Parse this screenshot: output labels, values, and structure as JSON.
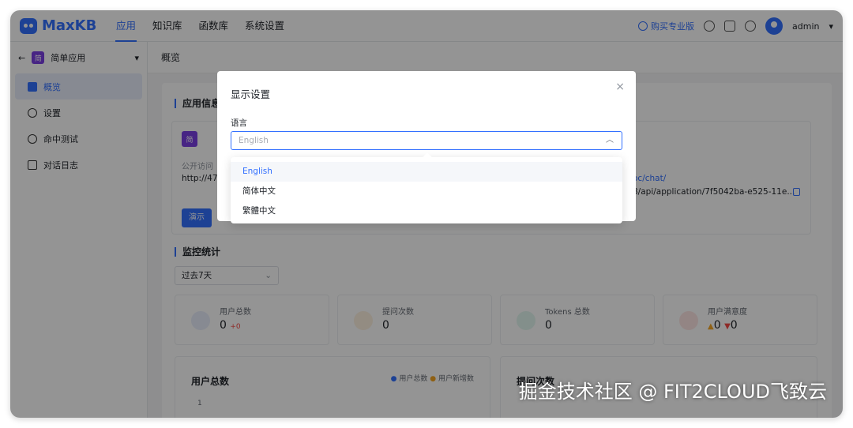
{
  "app": {
    "name": "MaxKB"
  },
  "nav": {
    "items": [
      "应用",
      "知识库",
      "函数库",
      "系统设置"
    ]
  },
  "topright": {
    "buy": "购买专业版",
    "user": "admin"
  },
  "sidebar": {
    "app_name": "简单应用",
    "app_badge": "简",
    "items": [
      {
        "label": "概览",
        "icon": "grid-icon"
      },
      {
        "label": "设置",
        "icon": "gear-icon"
      },
      {
        "label": "命中测试",
        "icon": "target-icon"
      },
      {
        "label": "对话日志",
        "icon": "log-icon"
      }
    ]
  },
  "page": {
    "title": "概览"
  },
  "app_info": {
    "section": "应用信息",
    "public_label": "公开访问",
    "url_prefix": "http://47",
    "api_link": "oc/chat/",
    "api_url": "8/api/application/7f5042ba-e525-11e...",
    "demo": "演示"
  },
  "monitor": {
    "section": "监控统计",
    "period": "过去7天",
    "stats": [
      {
        "label": "用户总数",
        "value": "0",
        "delta": "+0"
      },
      {
        "label": "提问次数",
        "value": "0"
      },
      {
        "label": "Tokens 总数",
        "value": "0"
      },
      {
        "label": "用户满意度",
        "up": "0",
        "down": "0"
      }
    ],
    "charts": [
      {
        "title": "用户总数",
        "legend": [
          "用户总数",
          "用户新增数"
        ],
        "tick": "1"
      },
      {
        "title": "提问次数"
      }
    ]
  },
  "dialog": {
    "title": "显示设置",
    "close": "×",
    "label": "语言",
    "placeholder": "English",
    "options": [
      "English",
      "简体中文",
      "繁體中文"
    ],
    "selected": "English"
  },
  "watermark": "掘金技术社区 @ FIT2CLOUD飞致云",
  "colors": {
    "accent": "#3370ff",
    "badge": "#7b3fe4"
  }
}
